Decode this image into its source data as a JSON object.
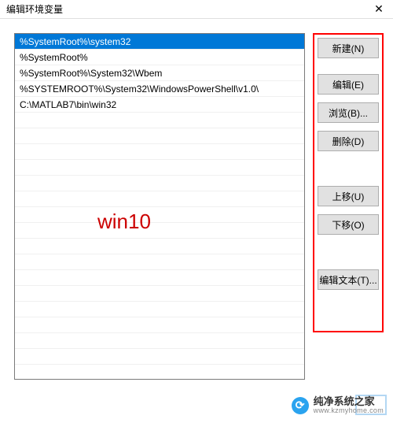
{
  "titlebar": {
    "title": "编辑环境变量"
  },
  "list": {
    "items": [
      "%SystemRoot%\\system32",
      "%SystemRoot%",
      "%SystemRoot%\\System32\\Wbem",
      "%SYSTEMROOT%\\System32\\WindowsPowerShell\\v1.0\\",
      "C:\\MATLAB7\\bin\\win32"
    ],
    "selected_index": 0
  },
  "overlay": "win10",
  "buttons": {
    "new": "新建(N)",
    "edit": "编辑(E)",
    "browse": "浏览(B)...",
    "delete": "删除(D)",
    "moveup": "上移(U)",
    "movedown": "下移(O)",
    "edittext": "编辑文本(T)..."
  },
  "watermark": {
    "icon_glyph": "⟳",
    "name": "纯净系统之家",
    "url": "www.kzmyhome.com"
  }
}
